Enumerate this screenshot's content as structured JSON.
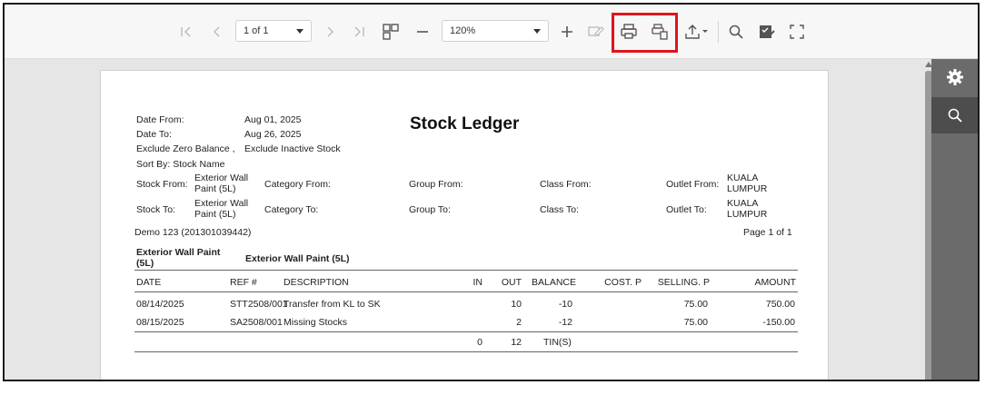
{
  "toolbar": {
    "page_select": "1 of 1",
    "zoom_select": "120%"
  },
  "report": {
    "title": "Stock Ledger",
    "date_from_label": "Date From:",
    "date_from": "Aug 01, 2025",
    "date_to_label": "Date To:",
    "date_to": "Aug 26, 2025",
    "options_a": "Exclude Zero Balance ,",
    "options_b": "Exclude Inactive Stock",
    "sort_by": "Sort By: Stock Name",
    "stock_from_label": "Stock From:",
    "stock_from": "Exterior Wall Paint (5L)",
    "stock_to_label": "Stock To:",
    "stock_to": "Exterior Wall Paint (5L)",
    "category_from_label": "Category From:",
    "category_to_label": "Category To:",
    "group_from_label": "Group From:",
    "group_to_label": "Group To:",
    "class_from_label": "Class From:",
    "class_to_label": "Class To:",
    "outlet_from_label": "Outlet From:",
    "outlet_from": "KUALA LUMPUR",
    "outlet_to_label": "Outlet To:",
    "outlet_to": "KUALA LUMPUR",
    "company": "Demo 123 (201301039442)",
    "page_info": "Page 1 of 1",
    "item_code": "Exterior Wall Paint (5L)",
    "item_name": "Exterior Wall Paint (5L)",
    "columns": [
      "DATE",
      "REF #",
      "DESCRIPTION",
      "IN",
      "OUT",
      "BALANCE",
      "COST. P",
      "SELLING. P",
      "AMOUNT"
    ],
    "rows": [
      {
        "date": "08/14/2025",
        "ref": "STT2508/001",
        "desc": "Transfer from KL to SK",
        "in": "",
        "out": "10",
        "balance": "-10",
        "cost": "",
        "selling": "75.00",
        "amount": "750.00"
      },
      {
        "date": "08/15/2025",
        "ref": "SA2508/001",
        "desc": "Missing Stocks",
        "in": "",
        "out": "2",
        "balance": "-12",
        "cost": "",
        "selling": "75.00",
        "amount": "-150.00"
      }
    ],
    "totals": {
      "in": "0",
      "out": "12",
      "unit": "TIN(S)"
    }
  }
}
